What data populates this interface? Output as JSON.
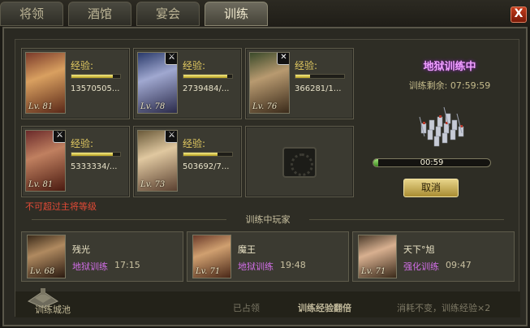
{
  "tabs": [
    {
      "label": "将领"
    },
    {
      "label": "酒馆"
    },
    {
      "label": "宴会"
    },
    {
      "label": "训练"
    }
  ],
  "close_label": "X",
  "training_slots": [
    {
      "level": "Lv. 81",
      "exp_label": "经验:",
      "exp_value": "13570505...",
      "exp_progress": 0.85,
      "badge": ""
    },
    {
      "level": "Lv. 78",
      "exp_label": "经验:",
      "exp_value": "2739484/...",
      "exp_progress": 0.9,
      "badge": "⚔"
    },
    {
      "level": "Lv. 76",
      "exp_label": "经验:",
      "exp_value": "366281/1...",
      "exp_progress": 0.3,
      "badge": "✕"
    },
    {
      "level": "Lv. 81",
      "exp_label": "经验:",
      "exp_value": "5333334/...",
      "exp_progress": 0.85,
      "badge": "⚔",
      "warning": "不可超过主将等级"
    },
    {
      "level": "Lv. 73",
      "exp_label": "经验:",
      "exp_value": "503692/7...",
      "exp_progress": 0.7,
      "badge": "⚔"
    }
  ],
  "status": {
    "title": "地狱训练中",
    "remaining": "训练剩余: 07:59:59",
    "progress_text": "00:59",
    "progress_fraction": 0.04,
    "cancel_label": "取消"
  },
  "players_section_title": "训练中玩家",
  "players": [
    {
      "name": "残光",
      "level": "Lv. 68",
      "mode": "地狱训练",
      "time": "17:15"
    },
    {
      "name": "魔王",
      "level": "Lv. 71",
      "mode": "地狱训练",
      "time": "19:48"
    },
    {
      "name": "天下°旭",
      "level": "Lv. 71",
      "mode": "强化训练",
      "time": "09:47"
    }
  ],
  "footer": {
    "fort_label": "训练城池",
    "occupied": "已占领",
    "double_exp": "训练经验翻倍",
    "cost_note": "消耗不变，训练经验×2"
  },
  "colors": {
    "accent_gold": "#e0c860",
    "status_purple": "#f0a0ff",
    "mode_purple": "#d26ee8",
    "warning_red": "#e24a36",
    "progress_green": "#3c8a1e"
  }
}
